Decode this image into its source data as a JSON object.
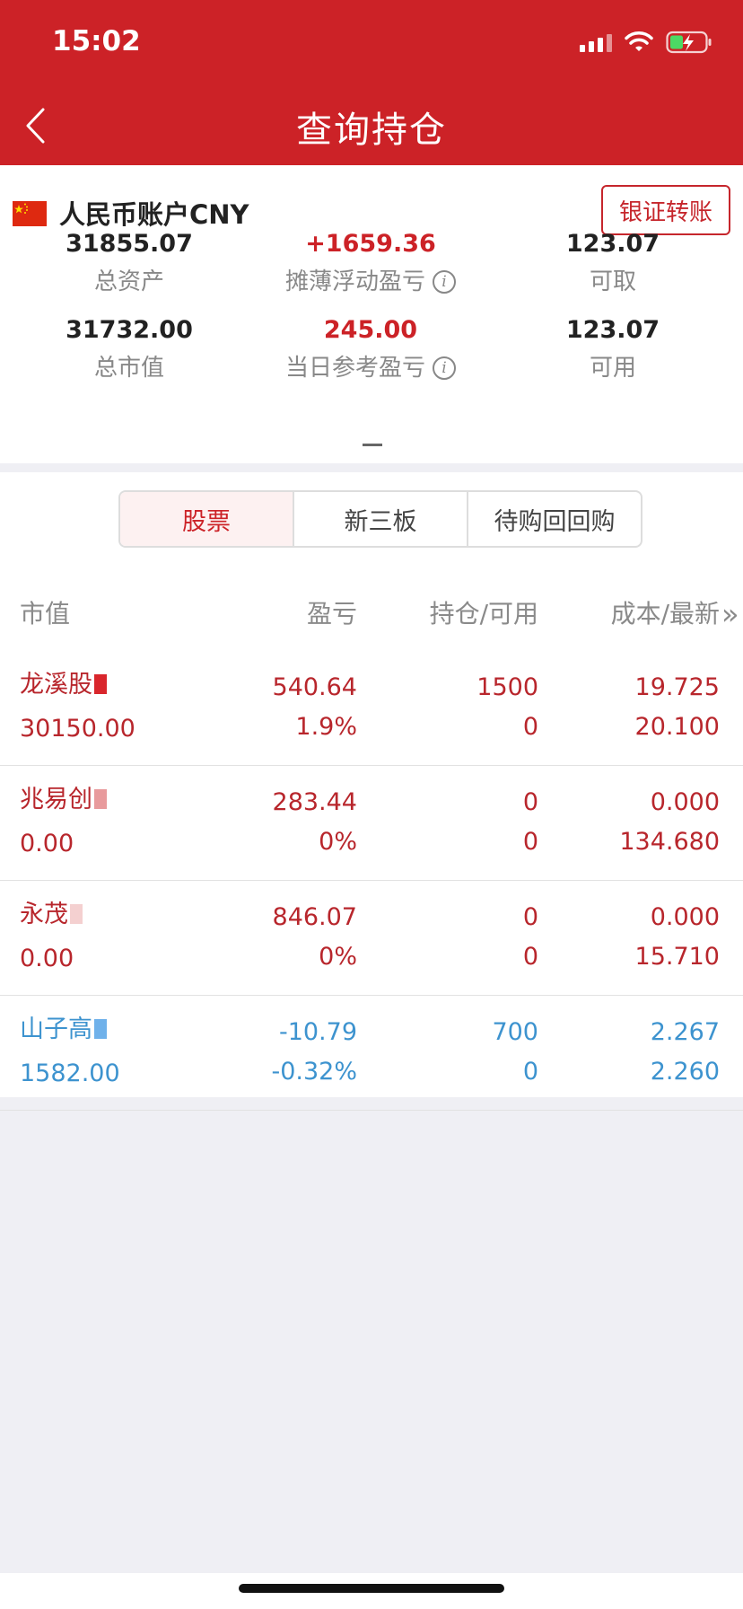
{
  "status": {
    "time": "15:02"
  },
  "nav": {
    "title": "查询持仓"
  },
  "account": {
    "title": "人民币账户CNY",
    "transfer_label": "银证转账",
    "summary": [
      {
        "value": "31855.07",
        "label": "总资产",
        "info": false,
        "red": false
      },
      {
        "value": "+1659.36",
        "label": "摊薄浮动盈亏",
        "info": true,
        "red": true
      },
      {
        "value": "123.07",
        "label": "可取",
        "info": false,
        "red": false
      },
      {
        "value": "31732.00",
        "label": "总市值",
        "info": false,
        "red": false
      },
      {
        "value": "245.00",
        "label": "当日参考盈亏",
        "info": true,
        "red": true
      },
      {
        "value": "123.07",
        "label": "可用",
        "info": false,
        "red": false
      }
    ]
  },
  "tabs": [
    "股票",
    "新三板",
    "待购回回购"
  ],
  "table": {
    "headers": {
      "market_value": "市值",
      "pnl": "盈亏",
      "hold": "持仓/可用",
      "cost": "成本/最新",
      "more": "»"
    },
    "rows": [
      {
        "name": "龙溪股",
        "market_value": "30150.00",
        "pnl": "540.64",
        "pnl_pct": "1.9%",
        "hold": "1500",
        "avail": "0",
        "cost": "19.725",
        "latest": "20.100",
        "color": "red",
        "mask": "#d9262c"
      },
      {
        "name": "兆易创",
        "market_value": "0.00",
        "pnl": "283.44",
        "pnl_pct": "0%",
        "hold": "0",
        "avail": "0",
        "cost": "0.000",
        "latest": "134.680",
        "color": "red",
        "mask": "#e89a9c"
      },
      {
        "name": "永茂",
        "market_value": "0.00",
        "pnl": "846.07",
        "pnl_pct": "0%",
        "hold": "0",
        "avail": "0",
        "cost": "0.000",
        "latest": "15.710",
        "color": "red",
        "mask": "#f4d0d0"
      },
      {
        "name": "山子高",
        "market_value": "1582.00",
        "pnl": "-10.79",
        "pnl_pct": "-0.32%",
        "hold": "700",
        "avail": "0",
        "cost": "2.267",
        "latest": "2.260",
        "color": "blue",
        "mask": "#6fb1ea"
      }
    ]
  },
  "colors": {
    "brand_red": "#cc2227",
    "loss_blue": "#3d93cf"
  }
}
